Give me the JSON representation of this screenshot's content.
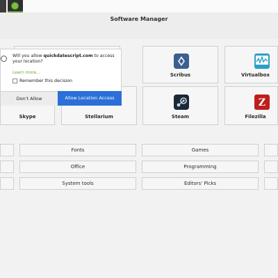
{
  "window": {
    "title": "Software Manager"
  },
  "apps": {
    "scribus": "Scribus",
    "virtualbox": "Virtualbox",
    "skype": "Skype",
    "stellarium": "Stellarium",
    "steam": "Steam",
    "filezilla": "Filezilla"
  },
  "categories": {
    "fonts": "Fonts",
    "games": "Games",
    "office": "Office",
    "programming": "Programming",
    "system_tools": "System tools",
    "editors_picks": "Editors' Picks"
  },
  "dialog": {
    "prompt_prefix": "Will you allow ",
    "domain": "quickdatescript.com",
    "prompt_suffix": " to access your location?",
    "learn_more": "Learn more...",
    "remember": "Remember this decision",
    "dont_allow": "Don't Allow",
    "allow": "Allow Location Access"
  },
  "colors": {
    "accent": "#2b6fd8",
    "link": "#6aaa3f"
  }
}
